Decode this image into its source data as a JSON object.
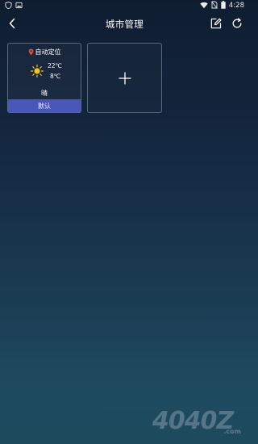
{
  "status_bar": {
    "time": "4:28"
  },
  "header": {
    "title": "城市管理"
  },
  "cities": [
    {
      "location": "自动定位",
      "temp_high": "22℃",
      "temp_low": "8℃",
      "weather": "晴",
      "default_label": "默认"
    }
  ],
  "watermark": {
    "text": "4040Z",
    "suffix": ".com"
  },
  "colors": {
    "accent": "#4a57b8",
    "location_pin": "#e0523c",
    "sun": "#f5c518"
  },
  "icons": {
    "back": "chevron-left-icon",
    "edit": "edit-icon",
    "refresh": "refresh-icon",
    "add": "plus-icon",
    "location": "location-pin-icon",
    "weather": "sun-icon"
  }
}
